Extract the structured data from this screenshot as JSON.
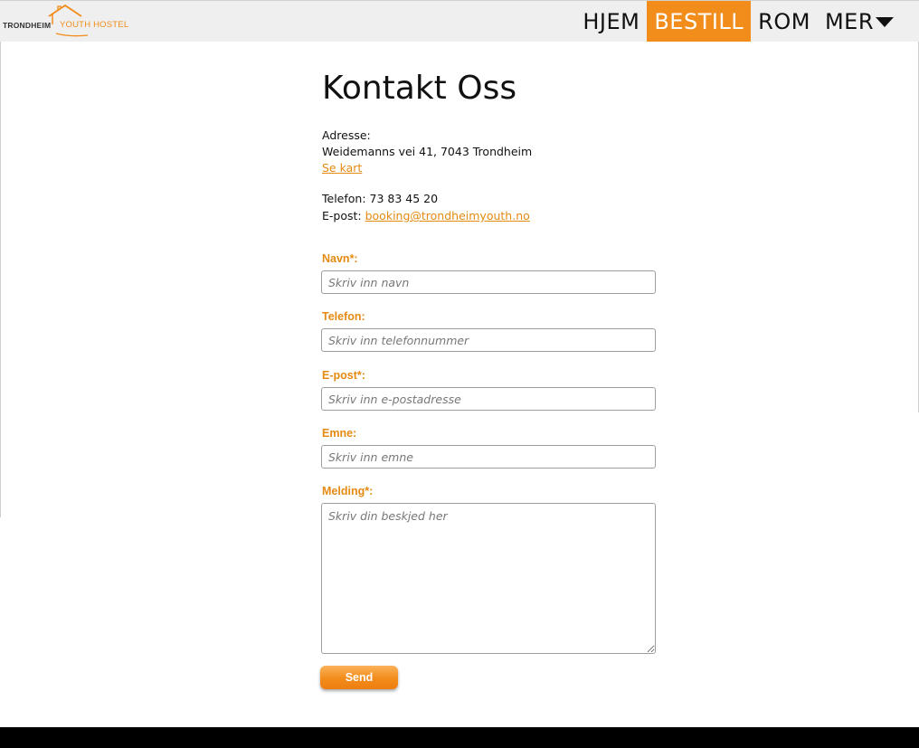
{
  "brand": {
    "name_left": "TRONDHEIM",
    "name_right": "YOUTH HOSTEL",
    "logo_icon": "house-roof-icon",
    "accent": "#f28c1a"
  },
  "nav": {
    "items": [
      {
        "label": "HJEM",
        "active": false
      },
      {
        "label": "BESTILL",
        "active": true
      },
      {
        "label": "ROM",
        "active": false
      },
      {
        "label": "MER",
        "active": false,
        "icon": "caret-down-icon"
      }
    ]
  },
  "page": {
    "title": "Kontakt Oss",
    "address_label": "Adresse:",
    "address": "Weidemanns vei 41, 7043 Trondheim",
    "map_link": "Se kart",
    "phone": "Telefon: 73 83 45 20",
    "email_prefix": "E-post: ",
    "email": "booking@trondheimyouth.no"
  },
  "form": {
    "name_label": "Navn*:",
    "name_placeholder": "Skriv inn navn",
    "phone_label": "Telefon:",
    "phone_placeholder": "Skriv inn telefonnummer",
    "email_label": "E-post*:",
    "email_placeholder": "Skriv inn e-postadresse",
    "subject_label": "Emne:",
    "subject_placeholder": "Skriv inn emne",
    "message_label": "Melding*:",
    "message_placeholder": "Skriv din beskjed her",
    "send_label": "Send"
  }
}
